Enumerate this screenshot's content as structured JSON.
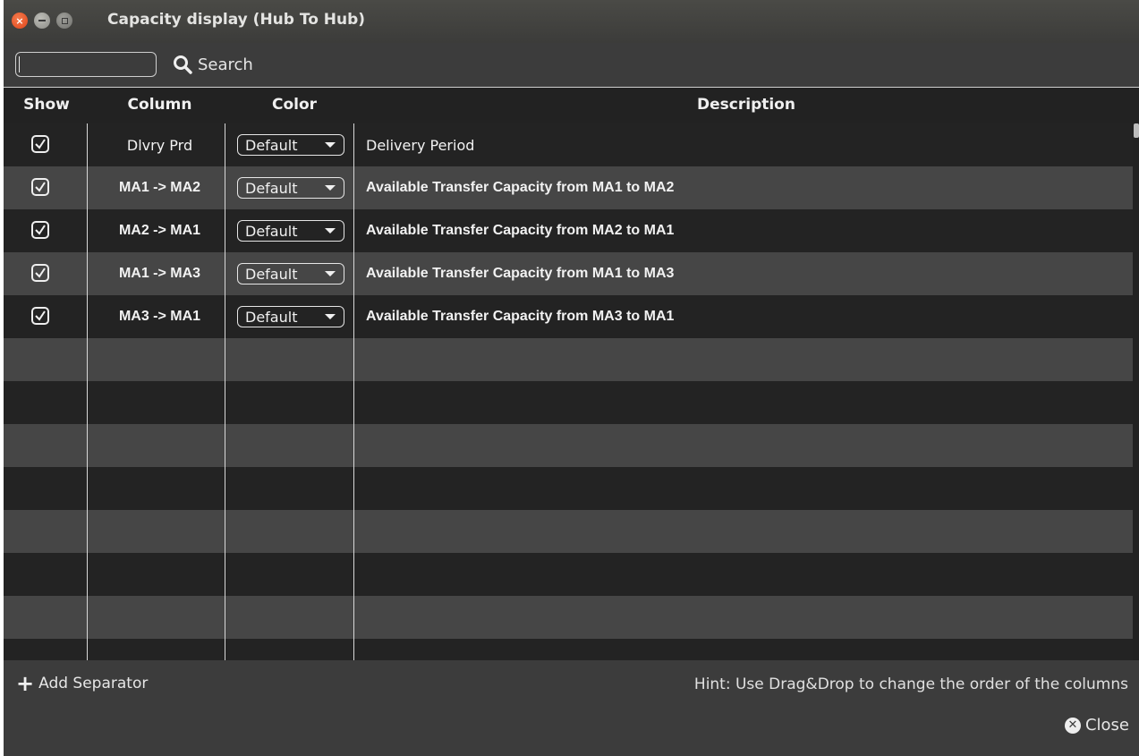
{
  "window": {
    "title": "Capacity display (Hub To Hub)",
    "close_glyph": "×"
  },
  "search": {
    "value": "",
    "button_label": "Search"
  },
  "table": {
    "headers": {
      "show": "Show",
      "column": "Column",
      "color": "Color",
      "description": "Description"
    },
    "rows": [
      {
        "show": true,
        "column": "Dlvry Prd",
        "color": "Default",
        "description": "Delivery Period"
      },
      {
        "show": true,
        "column": "MA1 -> MA2",
        "color": "Default",
        "description": "Available Transfer Capacity from MA1 to MA2"
      },
      {
        "show": true,
        "column": "MA2 -> MA1",
        "color": "Default",
        "description": "Available Transfer Capacity from MA2 to MA1"
      },
      {
        "show": true,
        "column": "MA1 -> MA3",
        "color": "Default",
        "description": "Available Transfer Capacity from MA1 to MA3"
      },
      {
        "show": true,
        "column": "MA3 -> MA1",
        "color": "Default",
        "description": "Available Transfer Capacity from MA3 to MA1"
      }
    ]
  },
  "footer": {
    "add_separator_label": "Add Separator",
    "hint": "Hint: Use Drag&Drop to change the order of the columns",
    "close_label": "Close",
    "close_glyph": "✕"
  },
  "icons": {
    "window_close": "close-icon",
    "window_minimize": "minimize-icon",
    "window_maximize": "maximize-icon",
    "search": "search-icon",
    "add": "plus-icon",
    "close": "close-circle-icon",
    "check": "checkmark-icon",
    "dropdown": "caret-down-icon"
  },
  "colors": {
    "titlebar": "#3c3c3a",
    "window_bg": "#3c3c3c",
    "row_dark": "#232323",
    "row_light": "#464646",
    "close_button": "#e0461b"
  }
}
